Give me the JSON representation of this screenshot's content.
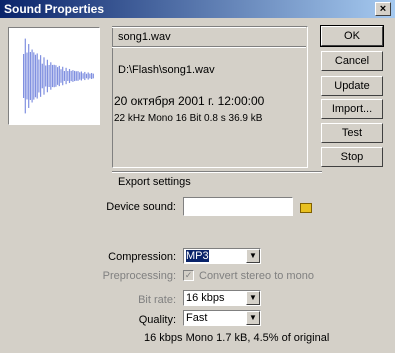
{
  "window": {
    "title": "Sound Properties",
    "close_label": "×"
  },
  "info": {
    "name": "song1.wav",
    "path": "D:\\Flash\\song1.wav",
    "date": "20 октября 2001 г. 12:00:00",
    "details": "22 kHz Mono 16 Bit 0.8 s 36.9 kB"
  },
  "buttons": {
    "ok": "OK",
    "cancel": "Cancel",
    "update": "Update",
    "import": "Import...",
    "test": "Test",
    "stop": "Stop"
  },
  "export": {
    "heading": "Export settings",
    "device_sound_label": "Device sound:",
    "device_sound_value": "",
    "compression_label": "Compression:",
    "compression_value": "MP3",
    "preprocessing_label": "Preprocessing:",
    "preprocessing_option": "Convert stereo to mono",
    "preprocessing_checked": true,
    "bitrate_label": "Bit rate:",
    "bitrate_value": "16 kbps",
    "quality_label": "Quality:",
    "quality_value": "Fast",
    "summary": "16 kbps Mono 1.7 kB, 4.5% of original"
  },
  "icons": {
    "folder": "folder-icon",
    "waveform": "waveform-icon",
    "dropdown": "chevron-down-icon"
  },
  "colors": {
    "waveform": "#8090e0",
    "title_bar_start": "#0a246a",
    "title_bar_end": "#a6caf0"
  }
}
